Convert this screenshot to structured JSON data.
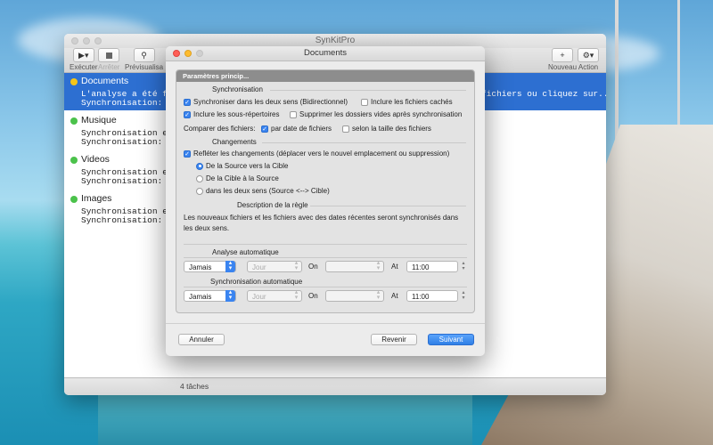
{
  "main_window": {
    "title": "SynKitPro",
    "toolbar": {
      "executer": "Exécuter",
      "arreter": "Arrêter",
      "previsualisation": "Prévisualisa",
      "nouveau": "Nouveau",
      "action": "Action"
    },
    "tasks": [
      {
        "name": "Documents",
        "line1": "L'analyse a été faite",
        "line1_tail": "fichiers ou cliquez sur...",
        "line2": "Synchronisation: Manu",
        "color": "#f5c518"
      },
      {
        "name": "Musique",
        "line1": "Synchronisation effec",
        "line2": "Synchronisation: Manu",
        "color": "#4bc24b"
      },
      {
        "name": "Videos",
        "line1": "Synchronisation effec",
        "line2": "Synchronisation: Manu",
        "color": "#4bc24b"
      },
      {
        "name": "Images",
        "line1": "Synchronisation effec",
        "line2": "Synchronisation: Manu",
        "color": "#4bc24b"
      }
    ],
    "status": "4 tâches"
  },
  "sheet": {
    "title": "Documents",
    "tab": "Paramètres princip...",
    "sync_section": "Synchronisation",
    "bidir": "Synchroniser dans les deux sens (Bidirectionnel)",
    "hidden": "Inclure les fichiers cachés",
    "subdirs": "Inclure les sous-répertoires",
    "delete_empty": "Supprimer les dossiers vides après synchronisation",
    "compare_label": "Comparer des fichiers:",
    "by_date": "par date de fichiers",
    "by_size": "selon la taille des fichiers",
    "changes_section": "Changements",
    "reflect": "Refléter les changements (déplacer vers le nouvel emplacement ou suppression)",
    "dir1": "De la Source vers la Cible",
    "dir2": "De la Cible à la Source",
    "dir3": "dans les deux sens (Source <--> Cible)",
    "rule_section": "Description de la règle",
    "rule_text": "Les nouveaux fichiers et les fichiers avec des dates récentes seront synchronisés dans les deux sens.",
    "auto_analysis": "Analyse automatique",
    "auto_sync": "Synchronisation automatique",
    "freq": "Jamais",
    "day": "Jour",
    "on": "On",
    "at": "At",
    "time": "11:00",
    "cancel": "Annuler",
    "back": "Revenir",
    "next": "Suivant"
  }
}
